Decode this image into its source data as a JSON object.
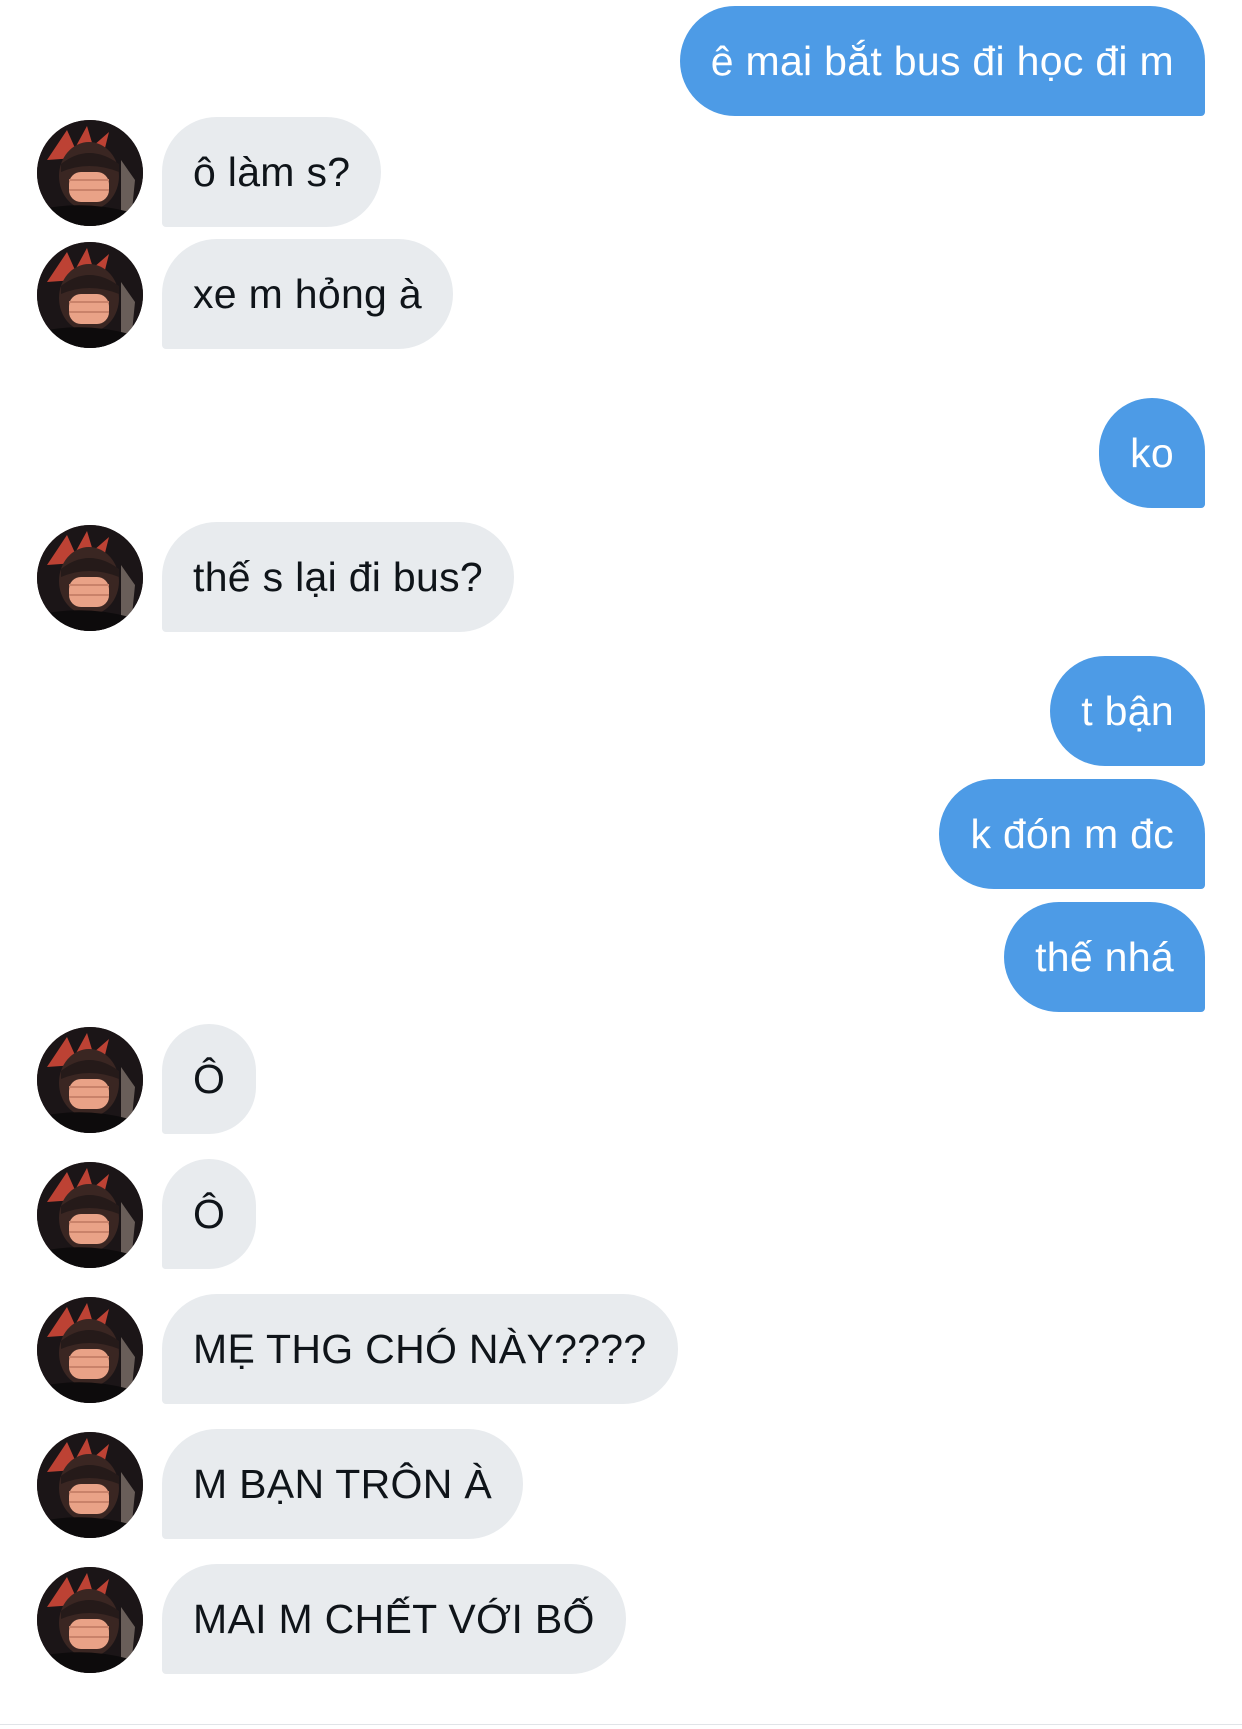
{
  "conversation": {
    "messages": [
      {
        "side": "out",
        "text": "ê mai bắt bus đi học đi m"
      },
      {
        "side": "in",
        "text": "ô làm s?"
      },
      {
        "side": "in",
        "text": "xe m hỏng à"
      },
      {
        "side": "out",
        "text": "ko"
      },
      {
        "side": "in",
        "text": "thế s lại đi bus?"
      },
      {
        "side": "out",
        "text": "t bận"
      },
      {
        "side": "out",
        "text": "k đón m đc"
      },
      {
        "side": "out",
        "text": "thế nhá"
      },
      {
        "side": "in",
        "text": "Ô"
      },
      {
        "side": "in",
        "text": "Ô"
      },
      {
        "side": "in",
        "text": "MẸ THG CHÓ NÀY????"
      },
      {
        "side": "in",
        "text": "M BẠN TRÔN À"
      },
      {
        "side": "in",
        "text": "MAI M CHẾT VỚI BỐ"
      }
    ]
  },
  "colors": {
    "outgoing_bubble": "#4d9be6",
    "incoming_bubble": "#e8ebee",
    "outgoing_text": "#ffffff",
    "incoming_text": "#0f1419",
    "background": "#ffffff"
  },
  "icons": {
    "avatar": "contact-avatar-photo"
  }
}
